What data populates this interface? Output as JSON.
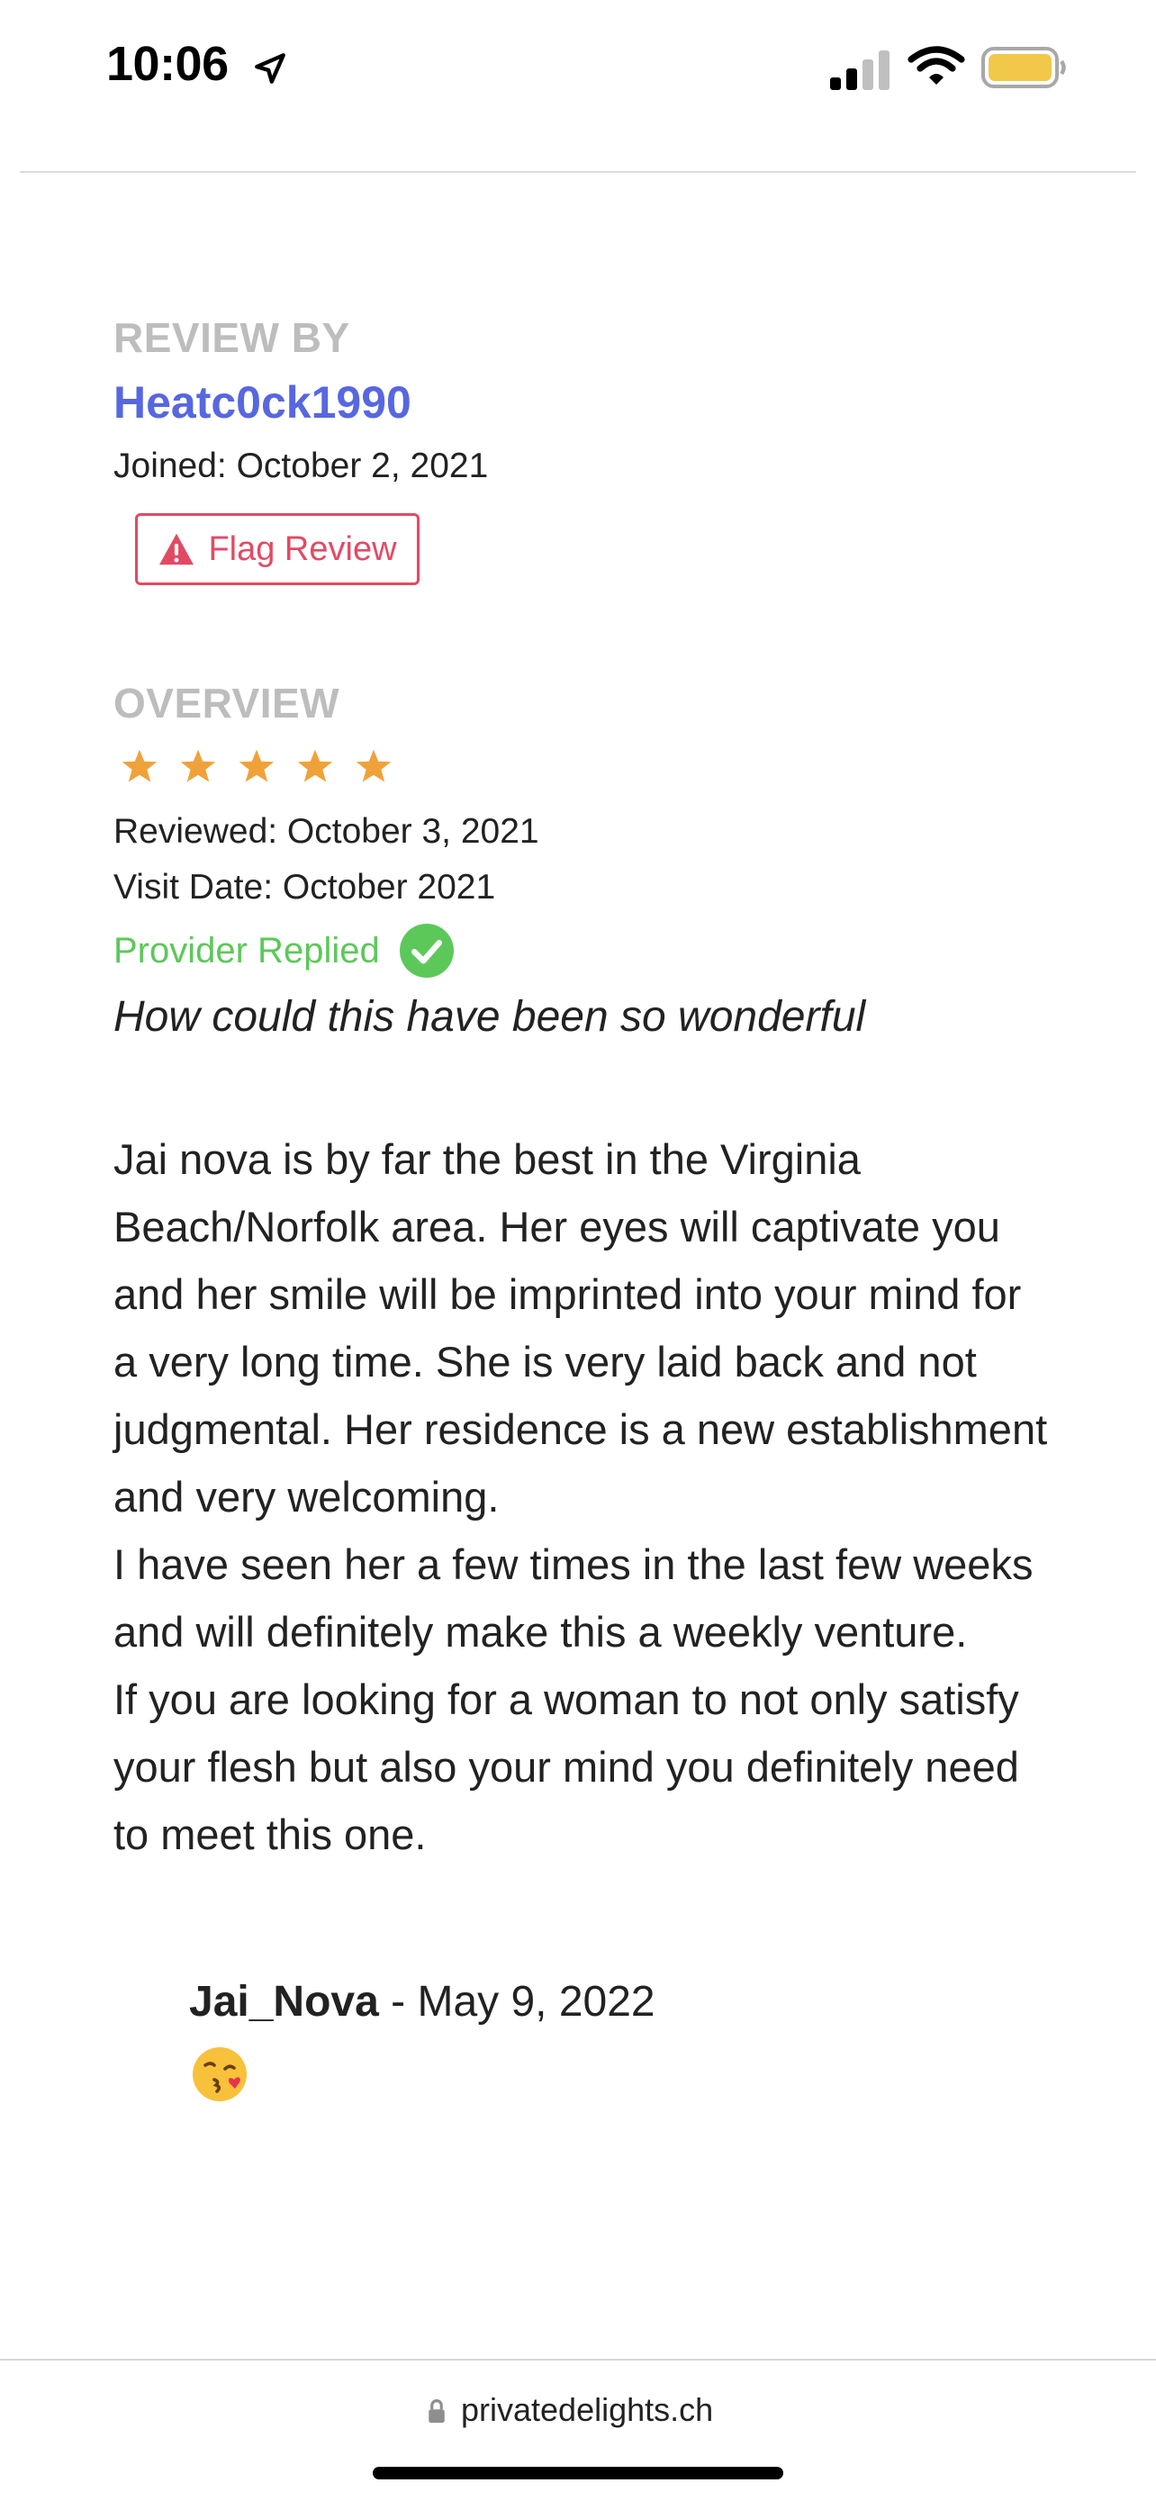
{
  "status_bar": {
    "time": "10:06"
  },
  "review": {
    "section_label": "REVIEW BY",
    "username": "Heatc0ck1990",
    "joined": "Joined: October 2, 2021",
    "flag_label": "Flag Review"
  },
  "overview": {
    "section_label": "OVERVIEW",
    "rating": 5,
    "rating_max": 5,
    "reviewed": "Reviewed: October 3, 2021",
    "visit_date": "Visit Date: October 2021",
    "provider_replied": "Provider Replied",
    "headline": "How could this have been so wonderful",
    "body": "Jai nova is by far the best in the Virginia\nBeach/Norfolk area. Her eyes will captivate you\nand her smile will be imprinted into your mind for\na very long time. She is very laid back and not\njudgmental. Her residence is a new establishment\nand very welcoming.\nI have seen her a few times in the last few weeks\nand will definitely make this a weekly venture.\nIf you are looking for a woman to not only satisfy\nyour flesh but also your mind you definitely need\nto meet this one."
  },
  "reply": {
    "author": "Jai_Nova",
    "separator": " - ",
    "date": "May 9, 2022",
    "emoji": "kissing-face-with-heart"
  },
  "browser": {
    "url": "privatedelights.ch"
  },
  "colors": {
    "accent_blue": "#5767e0",
    "flag_red": "#e24a64",
    "star_orange": "#f0a23a",
    "replied_green": "#5cc85a",
    "label_gray": "#bdbdbd"
  }
}
